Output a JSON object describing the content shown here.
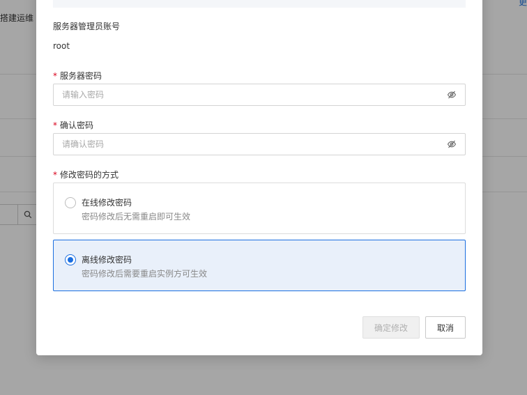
{
  "background": {
    "breadcrumb_fragment": "搭建运维",
    "top_right_link_fragment": "更",
    "search_button_icon": "search-icon"
  },
  "dialog": {
    "admin_account": {
      "label": "服务器管理员账号",
      "value": "root"
    },
    "password": {
      "label": "服务器密码",
      "required_mark": "*",
      "value": "",
      "placeholder": "请输入密码",
      "toggle_icon": "eye-off-icon"
    },
    "confirm_password": {
      "label": "确认密码",
      "required_mark": "*",
      "value": "",
      "placeholder": "请确认密码",
      "toggle_icon": "eye-off-icon"
    },
    "method": {
      "label": "修改密码的方式",
      "required_mark": "*",
      "selected": "offline",
      "options": [
        {
          "id": "online",
          "title": "在线修改密码",
          "desc": "密码修改后无需重启即可生效",
          "selected": false
        },
        {
          "id": "offline",
          "title": "离线修改密码",
          "desc": "密码修改后需要重启实例方可生效",
          "selected": true
        }
      ]
    },
    "footer": {
      "confirm_label": "确定修改",
      "confirm_disabled": true,
      "cancel_label": "取消"
    }
  },
  "colors": {
    "accent": "#1a6ee0",
    "required": "#d9001b",
    "selected_bg": "#e9f0fa",
    "overlay": "rgba(0,0,0,0.35)"
  }
}
